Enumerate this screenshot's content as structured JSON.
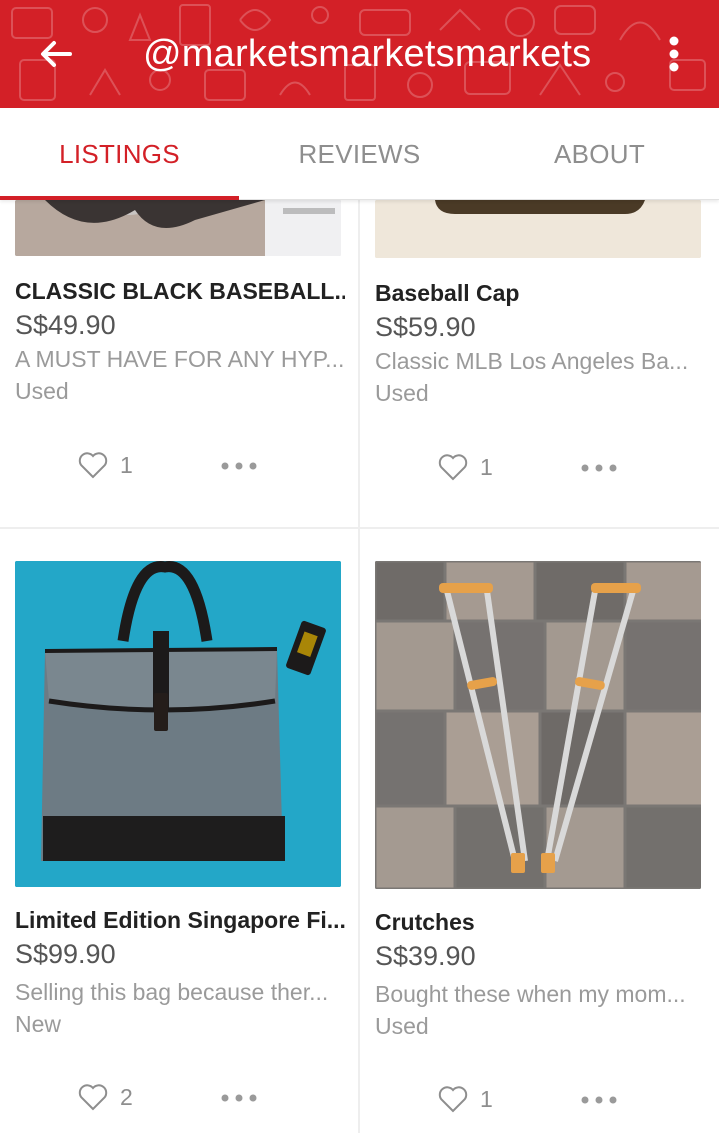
{
  "header": {
    "title": "@marketsmarketsmarkets",
    "back_icon": "arrow-left-icon",
    "menu_icon": "more-vertical-icon",
    "background_color": "#d32027"
  },
  "tabs": [
    {
      "label": "LISTINGS",
      "active": true
    },
    {
      "label": "REVIEWS",
      "active": false
    },
    {
      "label": "ABOUT",
      "active": false
    }
  ],
  "accent_color": "#d32027",
  "listings": [
    {
      "name": "CLASSIC BLACK BASEBALL...",
      "price": "S$49.90",
      "description": "A MUST HAVE FOR ANY HYP...",
      "condition": "Used",
      "likes": "1",
      "image": "black-cap-photo"
    },
    {
      "name": "Baseball Cap",
      "price": "S$59.90",
      "description": "Classic MLB Los Angeles Ba...",
      "condition": "Used",
      "likes": "1",
      "image": "baseball-cap-photo"
    },
    {
      "name": "Limited Edition Singapore Fi...",
      "price": "S$99.90",
      "description": "Selling this bag because ther...",
      "condition": "New",
      "likes": "2",
      "image": "grey-tote-bag-photo"
    },
    {
      "name": "Crutches",
      "price": "S$39.90",
      "description": "Bought these when my mom...",
      "condition": "Used",
      "likes": "1",
      "image": "crutches-photo"
    }
  ]
}
